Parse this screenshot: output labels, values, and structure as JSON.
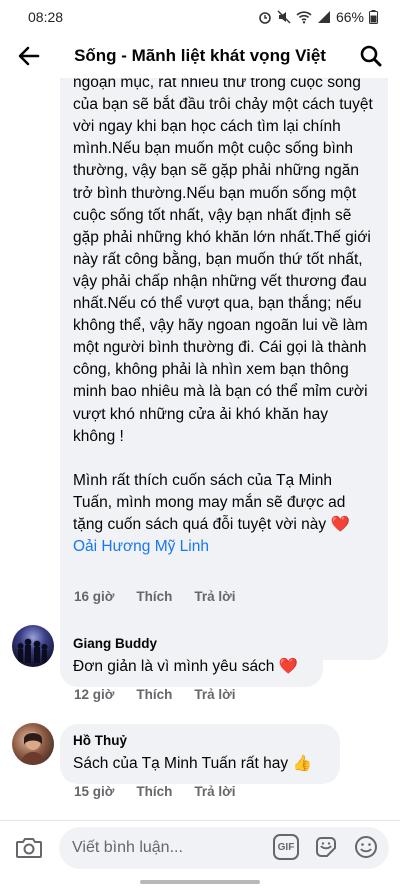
{
  "status_bar": {
    "time": "08:28",
    "battery": "66%"
  },
  "header": {
    "title": "Sống - Mãnh liệt khát vọng Việt"
  },
  "main_comment": {
    "paragraph1": "độ cốt lõi sẽ giải phóng bạn một cách ngoạn mục, rất nhiều thứ trong cuộc sống của bạn sẽ bắt đầu trôi chảy một cách tuyệt vời ngay khi bạn học cách tìm lại chính mình.Nếu bạn muốn một cuộc sống bình thường, vậy bạn sẽ gặp phải những ngăn trở bình thường.Nếu bạn muốn sống một cuộc sống tốt nhất, vậy bạn nhất định sẽ gặp phải những khó khăn lớn nhất.Thế giới này rất công bằng, bạn muốn thứ tốt nhất, vậy phải chấp nhận những vết thương đau nhất.Nếu có thể vượt qua, bạn thắng; nếu không thể, vậy hãy ngoan ngoãn lui về làm một người bình thường đi. Cái gọi là thành công, không phải là nhìn xem bạn thông minh bao nhiêu mà là bạn có thể mỉm cười vượt khó những cửa ải khó khăn hay không !",
    "paragraph2": "Mình rất thích cuốn sách của Tạ Minh Tuấn, mình mong  may mắn sẽ được ad tặng cuốn sách quá đỗi tuyệt vời này",
    "heart": "❤️",
    "mention": "Oải Hương Mỹ Linh",
    "time": "16 giờ",
    "like": "Thích",
    "reply": "Trả lời"
  },
  "comments": [
    {
      "name": "Giang Buddy",
      "text": "Đơn giản là vì mình yêu sách",
      "emoji": "❤️",
      "time": "12 giờ",
      "like": "Thích",
      "reply": "Trả lời"
    },
    {
      "name": "Hồ Thuỷ",
      "text": "Sách của Tạ Minh Tuấn rất hay",
      "emoji": "👍",
      "time": "15 giờ",
      "like": "Thích",
      "reply": "Trả lời"
    }
  ],
  "composer": {
    "placeholder": "Viết bình luận...",
    "gif_label": "GIF"
  },
  "icons": {
    "back": "arrow-left-icon",
    "search": "search-icon",
    "camera": "camera-icon",
    "gif": "gif-icon",
    "sticker": "sticker-icon",
    "emoji": "smiley-icon"
  },
  "colors": {
    "accent": "#1877f2",
    "bubble": "#f0f2f5",
    "muted": "#65676b",
    "heart": "#e41e3f"
  }
}
